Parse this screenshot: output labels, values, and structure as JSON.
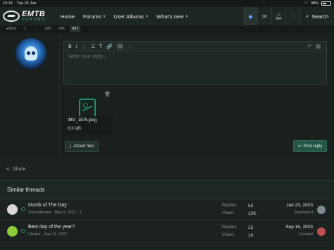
{
  "statusbar": {
    "time": "16:14",
    "date": "Tue 25 Jun",
    "battery": "38%"
  },
  "nav": {
    "logo_main": "EMTB",
    "logo_sub": "FORUMS",
    "items": [
      {
        "label": "Home"
      },
      {
        "label": "Forums"
      },
      {
        "label": "User Albums"
      },
      {
        "label": "What's new"
      }
    ],
    "search_label": "Search"
  },
  "pager": {
    "prev": "◂ Prev",
    "pages": [
      "1",
      "…",
      "435",
      "436",
      "437"
    ],
    "current": "437"
  },
  "editor": {
    "placeholder": "Write your reply...",
    "toolbar": [
      "B",
      "I",
      "⋮",
      "☰",
      "¶",
      "🔗",
      "🖼",
      "⋮"
    ]
  },
  "attachment": {
    "filename": "IMG_1875.jpeg",
    "size": "8.3 MB"
  },
  "buttons": {
    "attach": "Attach files",
    "post": "Post reply"
  },
  "share_label": "Share",
  "similar": {
    "heading": "Similar threads",
    "replies_label": "Replies:",
    "views_label": "Views:",
    "threads": [
      {
        "title": "Dumb of The Day",
        "meta": "Zimmerframe · May 9, 2021 · 2",
        "replies": "53",
        "views": "12K",
        "date": "Jan 23, 2023",
        "user": "SwampNut",
        "avatar_color": "#d8d8d8",
        "user_avatar_color": "#7c8a96"
      },
      {
        "title": "Best day of the year?",
        "meta": "Chabol · Sep 12, 2023",
        "replies": "15",
        "views": "1K",
        "date": "Sep 16, 2023",
        "user": "Grendel",
        "avatar_color": "#8fcc3a",
        "user_avatar_color": "#c0504d"
      }
    ]
  },
  "colors": {
    "accent": "#1f8f73",
    "post_button": "#245546"
  }
}
